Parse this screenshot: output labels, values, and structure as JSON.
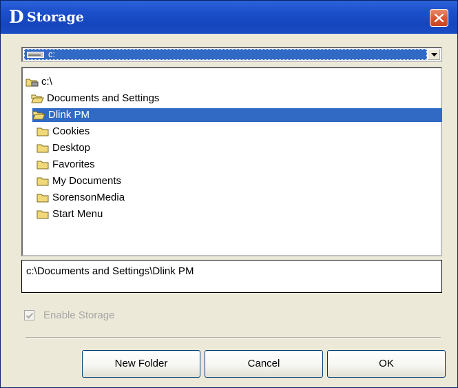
{
  "window": {
    "title": "Storage",
    "logo_letter": "D"
  },
  "drive_selector": {
    "selected": "c:"
  },
  "tree": {
    "items": [
      {
        "label": "c:\\",
        "icon": "drive-folder-icon"
      },
      {
        "label": "Documents and Settings",
        "icon": "open-folder-icon"
      },
      {
        "label": "Dlink PM",
        "icon": "open-folder-icon"
      },
      {
        "label": "Cookies",
        "icon": "folder-icon"
      },
      {
        "label": "Desktop",
        "icon": "folder-icon"
      },
      {
        "label": "Favorites",
        "icon": "folder-icon"
      },
      {
        "label": "My Documents",
        "icon": "folder-icon"
      },
      {
        "label": "SorensonMedia",
        "icon": "folder-icon"
      },
      {
        "label": "Start Menu",
        "icon": "folder-icon"
      }
    ],
    "selected_index": 2
  },
  "path": {
    "value": "c:\\Documents and Settings\\Dlink PM"
  },
  "enable_storage": {
    "label": "Enable Storage",
    "checked": true,
    "disabled": true
  },
  "buttons": {
    "new_folder": "New Folder",
    "cancel": "Cancel",
    "ok": "OK"
  },
  "colors": {
    "titlebar": "#1c4fcb",
    "selection": "#316ac5",
    "close": "#d8552f",
    "dialog_bg": "#ece9d8"
  }
}
